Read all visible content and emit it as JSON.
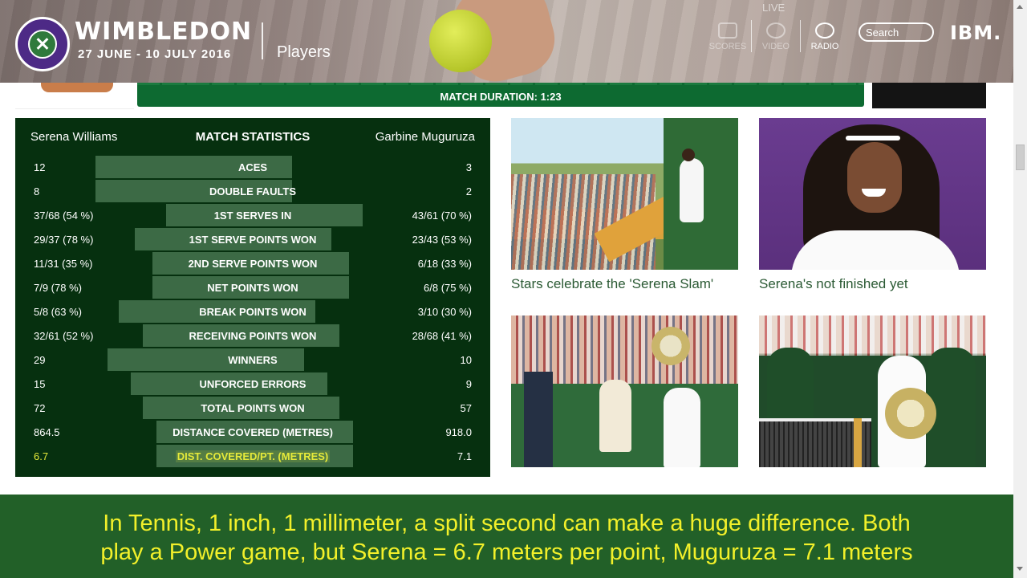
{
  "header": {
    "brand": "WIMBLEDON",
    "dates": "27 JUNE - 10 JULY 2016",
    "section": "Players",
    "live_label": "LIVE",
    "nav": [
      {
        "label": "SCORES",
        "icon": "scoreboard-icon"
      },
      {
        "label": "VIDEO",
        "icon": "play-icon"
      },
      {
        "label": "RADIO",
        "icon": "radio-icon"
      }
    ],
    "search_label": "Search",
    "sponsor": "IBM."
  },
  "match": {
    "duration": "MATCH DURATION: 1:23"
  },
  "stats": {
    "player1": "Serena Williams",
    "title": "MATCH STATISTICS",
    "player2": "Garbine Muguruza",
    "rows": [
      {
        "label": "ACES",
        "p1": "12",
        "p2": "3",
        "l": 0.8,
        "r": 0.2
      },
      {
        "label": "DOUBLE FAULTS",
        "p1": "8",
        "p2": "2",
        "l": 0.8,
        "r": 0.2
      },
      {
        "label": "1ST SERVES IN",
        "p1": "37/68 (54 %)",
        "p2": "43/61 (70 %)",
        "l": 0.44,
        "r": 0.56
      },
      {
        "label": "1ST SERVE POINTS WON",
        "p1": "29/37 (78 %)",
        "p2": "23/43 (53 %)",
        "l": 0.6,
        "r": 0.4
      },
      {
        "label": "2ND SERVE POINTS WON",
        "p1": "11/31 (35 %)",
        "p2": "6/18 (33 %)",
        "l": 0.51,
        "r": 0.49
      },
      {
        "label": "NET POINTS WON",
        "p1": "7/9 (78 %)",
        "p2": "6/8 (75 %)",
        "l": 0.51,
        "r": 0.49
      },
      {
        "label": "BREAK POINTS WON",
        "p1": "5/8 (63 %)",
        "p2": "3/10 (30 %)",
        "l": 0.68,
        "r": 0.32
      },
      {
        "label": "RECEIVING POINTS WON",
        "p1": "32/61 (52 %)",
        "p2": "28/68 (41 %)",
        "l": 0.56,
        "r": 0.44
      },
      {
        "label": "WINNERS",
        "p1": "29",
        "p2": "10",
        "l": 0.74,
        "r": 0.26
      },
      {
        "label": "UNFORCED ERRORS",
        "p1": "15",
        "p2": "9",
        "l": 0.62,
        "r": 0.38
      },
      {
        "label": "TOTAL POINTS WON",
        "p1": "72",
        "p2": "57",
        "l": 0.56,
        "r": 0.44
      },
      {
        "label": "DISTANCE COVERED (METRES)",
        "p1": "864.5",
        "p2": "918.0",
        "l": 0.49,
        "r": 0.51
      },
      {
        "label": "DIST. COVERED/PT. (METRES)",
        "p1": "6.7",
        "p2": "7.1",
        "l": 0.49,
        "r": 0.51,
        "highlight": true
      }
    ]
  },
  "articles": [
    {
      "caption": "Stars celebrate the 'Serena Slam'"
    },
    {
      "caption": "Serena's not finished yet"
    }
  ],
  "subtitle": {
    "line1": "In Tennis, 1 inch, 1 millimeter, a split second can make a huge difference. Both",
    "line2": "play a Power game, but Serena = 6.7 meters per point, Muguruza = 7.1 meters"
  }
}
